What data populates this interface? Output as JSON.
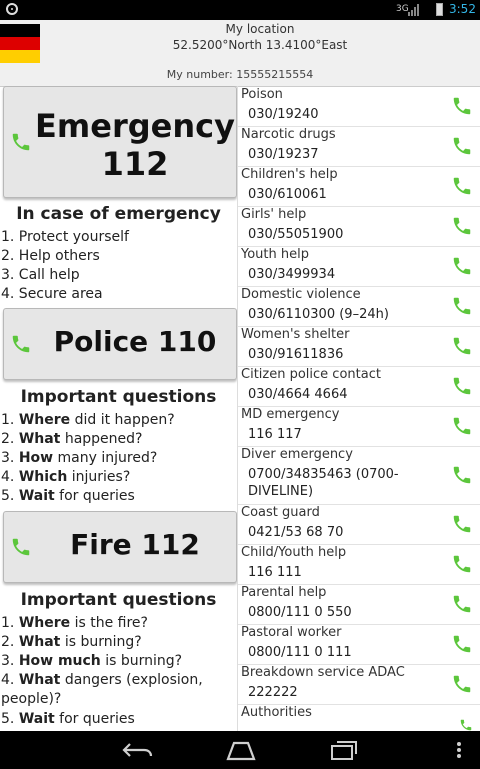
{
  "status_bar": {
    "time": "3:52",
    "signal_label": "3G"
  },
  "header": {
    "title": "My location",
    "coords": "52.5200°North 13.4100°East",
    "my_number": "My number: 15555215554",
    "flag_colors": [
      "#000000",
      "#dd0000",
      "#ffce00"
    ]
  },
  "left": {
    "emergency_btn": {
      "line1": "Emergency",
      "line2": "112"
    },
    "in_case": {
      "title": "In case of emergency",
      "items": [
        "1. Protect yourself",
        "2. Help others",
        "3. Call help",
        "4. Secure area"
      ]
    },
    "police_btn": {
      "label": "Police 110"
    },
    "questions1": {
      "title": "Important questions",
      "items": [
        {
          "num": "1.",
          "bold": "Where",
          "rest": " did it happen?"
        },
        {
          "num": "2.",
          "bold": "What",
          "rest": " happened?"
        },
        {
          "num": "3.",
          "bold": "How",
          "rest": " many injured?"
        },
        {
          "num": "4.",
          "bold": "Which",
          "rest": " injuries?"
        },
        {
          "num": "5.",
          "bold": "Wait",
          "rest": " for queries"
        }
      ]
    },
    "fire_btn": {
      "label": "Fire 112"
    },
    "questions2": {
      "title": "Important questions",
      "items": [
        {
          "num": "1.",
          "bold": "Where",
          "rest": " is the fire?"
        },
        {
          "num": "2.",
          "bold": "What",
          "rest": " is burning?"
        },
        {
          "num": "3.",
          "bold": "How much",
          "rest": " is burning?"
        },
        {
          "num": "4.",
          "bold": "What",
          "rest": " dangers (explosion,"
        },
        {
          "num": "",
          "bold": "",
          "rest": "people)?"
        },
        {
          "num": "5.",
          "bold": "Wait",
          "rest": " for queries"
        }
      ]
    }
  },
  "contacts": [
    {
      "name": "Poison",
      "number": "030/19240"
    },
    {
      "name": "Narcotic drugs",
      "number": "030/19237"
    },
    {
      "name": "Children's help",
      "number": "030/610061"
    },
    {
      "name": "Girls' help",
      "number": "030/55051900"
    },
    {
      "name": "Youth help",
      "number": "030/3499934"
    },
    {
      "name": "Domestic violence",
      "number": "030/6110300 (9–24h)"
    },
    {
      "name": "Women's shelter",
      "number": "030/91611836"
    },
    {
      "name": "Citizen police contact",
      "number": "030/4664 4664"
    },
    {
      "name": "MD emergency",
      "number": "116 117"
    },
    {
      "name": "Diver emergency",
      "number": "0700/34835463 (0700-DIVELINE)"
    },
    {
      "name": "Coast guard",
      "number": "0421/53 68 70"
    },
    {
      "name": "Child/Youth help",
      "number": "116 111"
    },
    {
      "name": "Parental help",
      "number": "0800/111 0 550"
    },
    {
      "name": "Pastoral worker",
      "number": "0800/111 0 111"
    },
    {
      "name": "Breakdown service ADAC",
      "number": "222222"
    },
    {
      "name": "Authorities",
      "number": ""
    }
  ],
  "colors": {
    "call_green": "#5cc63c",
    "accent_blue": "#33b5e5"
  },
  "icons": {
    "call": "phone-icon",
    "back": "back-icon",
    "home": "home-icon",
    "recents": "recents-icon",
    "menu": "menu-icon"
  }
}
